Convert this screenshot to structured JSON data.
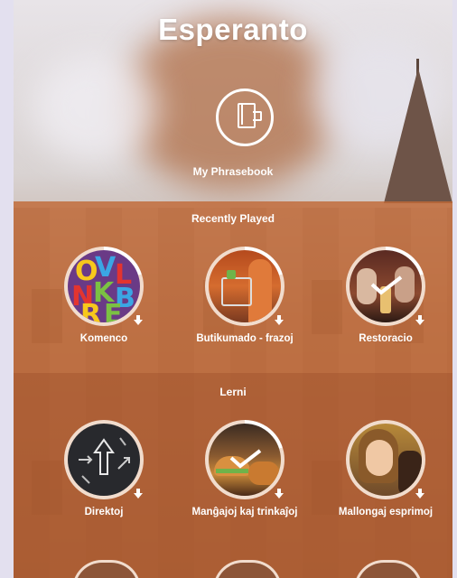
{
  "header": {
    "title": "Esperanto"
  },
  "phrasebook": {
    "label": "My Phrasebook",
    "icon": "phrasebook-icon"
  },
  "recently_played": {
    "title": "Recently Played",
    "items": [
      {
        "label": "Komenco",
        "icon": "download-icon"
      },
      {
        "label": "Butikumado - frazoj",
        "icon": "download-icon"
      },
      {
        "label": "Restoracio",
        "icon": "download-icon"
      }
    ]
  },
  "learn": {
    "title": "Lerni",
    "items": [
      {
        "label": "Direktoj",
        "icon": "download-icon"
      },
      {
        "label": "Manĝajoj kaj trinkaĵoj",
        "icon": "download-icon"
      },
      {
        "label": "Mallongaj esprimoj",
        "icon": "download-icon"
      }
    ]
  },
  "colors": {
    "band_top": "#c16937",
    "band_bottom": "#b05c30",
    "ring": "#f1dccd"
  }
}
